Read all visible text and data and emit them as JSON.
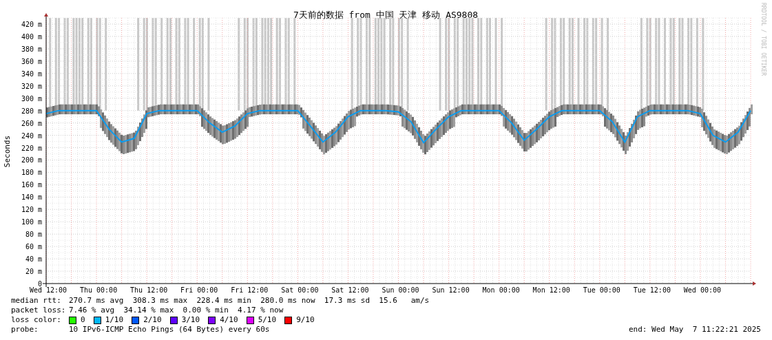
{
  "chart": {
    "side_text": "RRDTOOL / TOBI OETIKER",
    "chart_data": {
      "type": "line",
      "title": "7天前的数据 from 中国 天津 移动 AS9808",
      "ylabel": "Seconds",
      "ylim": [
        0,
        430
      ],
      "grid": true,
      "categories": [
        "Wed 12:00",
        null,
        null,
        null,
        "Thu 00:00",
        null,
        null,
        null,
        "Thu 12:00",
        null,
        null,
        null,
        "Fri 00:00",
        null,
        null,
        null,
        "Fri 12:00",
        null,
        null,
        null,
        "Sat 00:00",
        null,
        null,
        null,
        "Sat 12:00",
        null,
        null,
        null,
        "Sun 00:00",
        null,
        null,
        null,
        "Sun 12:00",
        null,
        null,
        null,
        "Mon 00:00",
        null,
        null,
        null,
        "Mon 12:00",
        null,
        null,
        null,
        "Tue 00:00",
        null,
        null,
        null,
        "Tue 12:00",
        null,
        null,
        null,
        "Wed 00:00",
        null,
        null,
        null,
        null
      ],
      "yticks": [
        {
          "value": 0,
          "label": "0"
        },
        {
          "value": 20,
          "label": "20 m"
        },
        {
          "value": 40,
          "label": "40 m"
        },
        {
          "value": 60,
          "label": "60 m"
        },
        {
          "value": 80,
          "label": "80 m"
        },
        {
          "value": 100,
          "label": "100 m"
        },
        {
          "value": 120,
          "label": "120 m"
        },
        {
          "value": 140,
          "label": "140 m"
        },
        {
          "value": 160,
          "label": "160 m"
        },
        {
          "value": 180,
          "label": "180 m"
        },
        {
          "value": 200,
          "label": "200 m"
        },
        {
          "value": 220,
          "label": "220 m"
        },
        {
          "value": 240,
          "label": "240 m"
        },
        {
          "value": 260,
          "label": "260 m"
        },
        {
          "value": 280,
          "label": "280 m"
        },
        {
          "value": 300,
          "label": "300 m"
        },
        {
          "value": 320,
          "label": "320 m"
        },
        {
          "value": 340,
          "label": "340 m"
        },
        {
          "value": 360,
          "label": "360 m"
        },
        {
          "value": 380,
          "label": "380 m"
        },
        {
          "value": 400,
          "label": "400 m"
        },
        {
          "value": 420,
          "label": "420 m"
        }
      ],
      "series": [
        {
          "color": "#0a9cf0",
          "values": [
            275,
            280,
            280,
            280,
            280,
            250,
            229,
            235,
            275,
            280,
            280,
            280,
            280,
            260,
            245,
            255,
            275,
            280,
            280,
            280,
            280,
            255,
            229,
            245,
            270,
            280,
            280,
            280,
            278,
            262,
            228,
            250,
            270,
            280,
            280,
            280,
            280,
            260,
            232,
            250,
            270,
            280,
            280,
            280,
            280,
            262,
            229,
            270,
            280,
            280,
            280,
            280,
            275,
            240,
            229,
            245,
            280
          ]
        }
      ]
    }
  },
  "legend": {
    "median_rtt": {
      "label": "median rtt:",
      "text": "270.7 ms avg  308.3 ms max  228.4 ms min  280.0 ms now  17.3 ms sd  15.6   am/s"
    },
    "packet_loss": {
      "label": "packet loss:",
      "text": "7.46 % avg  34.14 % max  0.00 % min  4.17 % now"
    },
    "loss_color": {
      "label": "loss color:",
      "items": [
        {
          "label": "0",
          "color": "#26ff00"
        },
        {
          "label": "1/10",
          "color": "#00b8ff"
        },
        {
          "label": "2/10",
          "color": "#0059ff"
        },
        {
          "label": "3/10",
          "color": "#5e00ff"
        },
        {
          "label": "4/10",
          "color": "#7e00ff"
        },
        {
          "label": "5/10",
          "color": "#dd00ff"
        },
        {
          "label": "9/10",
          "color": "#ff0000"
        }
      ]
    },
    "probe": {
      "label": "probe:",
      "text": "10 IPv6-ICMP Echo Pings (64 Bytes) every 60s"
    },
    "end": "end: Wed May  7 11:22:21 2025"
  }
}
